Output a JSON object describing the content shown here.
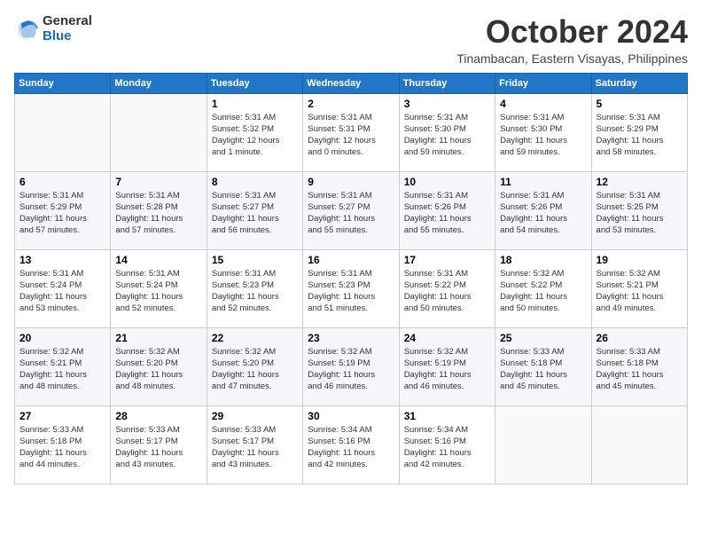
{
  "logo": {
    "general": "General",
    "blue": "Blue"
  },
  "title": "October 2024",
  "location": "Tinambacan, Eastern Visayas, Philippines",
  "days_of_week": [
    "Sunday",
    "Monday",
    "Tuesday",
    "Wednesday",
    "Thursday",
    "Friday",
    "Saturday"
  ],
  "weeks": [
    [
      {
        "day": "",
        "content": ""
      },
      {
        "day": "",
        "content": ""
      },
      {
        "day": "1",
        "content": "Sunrise: 5:31 AM\nSunset: 5:32 PM\nDaylight: 12 hours\nand 1 minute."
      },
      {
        "day": "2",
        "content": "Sunrise: 5:31 AM\nSunset: 5:31 PM\nDaylight: 12 hours\nand 0 minutes."
      },
      {
        "day": "3",
        "content": "Sunrise: 5:31 AM\nSunset: 5:30 PM\nDaylight: 11 hours\nand 59 minutes."
      },
      {
        "day": "4",
        "content": "Sunrise: 5:31 AM\nSunset: 5:30 PM\nDaylight: 11 hours\nand 59 minutes."
      },
      {
        "day": "5",
        "content": "Sunrise: 5:31 AM\nSunset: 5:29 PM\nDaylight: 11 hours\nand 58 minutes."
      }
    ],
    [
      {
        "day": "6",
        "content": "Sunrise: 5:31 AM\nSunset: 5:29 PM\nDaylight: 11 hours\nand 57 minutes."
      },
      {
        "day": "7",
        "content": "Sunrise: 5:31 AM\nSunset: 5:28 PM\nDaylight: 11 hours\nand 57 minutes."
      },
      {
        "day": "8",
        "content": "Sunrise: 5:31 AM\nSunset: 5:27 PM\nDaylight: 11 hours\nand 56 minutes."
      },
      {
        "day": "9",
        "content": "Sunrise: 5:31 AM\nSunset: 5:27 PM\nDaylight: 11 hours\nand 55 minutes."
      },
      {
        "day": "10",
        "content": "Sunrise: 5:31 AM\nSunset: 5:26 PM\nDaylight: 11 hours\nand 55 minutes."
      },
      {
        "day": "11",
        "content": "Sunrise: 5:31 AM\nSunset: 5:26 PM\nDaylight: 11 hours\nand 54 minutes."
      },
      {
        "day": "12",
        "content": "Sunrise: 5:31 AM\nSunset: 5:25 PM\nDaylight: 11 hours\nand 53 minutes."
      }
    ],
    [
      {
        "day": "13",
        "content": "Sunrise: 5:31 AM\nSunset: 5:24 PM\nDaylight: 11 hours\nand 53 minutes."
      },
      {
        "day": "14",
        "content": "Sunrise: 5:31 AM\nSunset: 5:24 PM\nDaylight: 11 hours\nand 52 minutes."
      },
      {
        "day": "15",
        "content": "Sunrise: 5:31 AM\nSunset: 5:23 PM\nDaylight: 11 hours\nand 52 minutes."
      },
      {
        "day": "16",
        "content": "Sunrise: 5:31 AM\nSunset: 5:23 PM\nDaylight: 11 hours\nand 51 minutes."
      },
      {
        "day": "17",
        "content": "Sunrise: 5:31 AM\nSunset: 5:22 PM\nDaylight: 11 hours\nand 50 minutes."
      },
      {
        "day": "18",
        "content": "Sunrise: 5:32 AM\nSunset: 5:22 PM\nDaylight: 11 hours\nand 50 minutes."
      },
      {
        "day": "19",
        "content": "Sunrise: 5:32 AM\nSunset: 5:21 PM\nDaylight: 11 hours\nand 49 minutes."
      }
    ],
    [
      {
        "day": "20",
        "content": "Sunrise: 5:32 AM\nSunset: 5:21 PM\nDaylight: 11 hours\nand 48 minutes."
      },
      {
        "day": "21",
        "content": "Sunrise: 5:32 AM\nSunset: 5:20 PM\nDaylight: 11 hours\nand 48 minutes."
      },
      {
        "day": "22",
        "content": "Sunrise: 5:32 AM\nSunset: 5:20 PM\nDaylight: 11 hours\nand 47 minutes."
      },
      {
        "day": "23",
        "content": "Sunrise: 5:32 AM\nSunset: 5:19 PM\nDaylight: 11 hours\nand 46 minutes."
      },
      {
        "day": "24",
        "content": "Sunrise: 5:32 AM\nSunset: 5:19 PM\nDaylight: 11 hours\nand 46 minutes."
      },
      {
        "day": "25",
        "content": "Sunrise: 5:33 AM\nSunset: 5:18 PM\nDaylight: 11 hours\nand 45 minutes."
      },
      {
        "day": "26",
        "content": "Sunrise: 5:33 AM\nSunset: 5:18 PM\nDaylight: 11 hours\nand 45 minutes."
      }
    ],
    [
      {
        "day": "27",
        "content": "Sunrise: 5:33 AM\nSunset: 5:18 PM\nDaylight: 11 hours\nand 44 minutes."
      },
      {
        "day": "28",
        "content": "Sunrise: 5:33 AM\nSunset: 5:17 PM\nDaylight: 11 hours\nand 43 minutes."
      },
      {
        "day": "29",
        "content": "Sunrise: 5:33 AM\nSunset: 5:17 PM\nDaylight: 11 hours\nand 43 minutes."
      },
      {
        "day": "30",
        "content": "Sunrise: 5:34 AM\nSunset: 5:16 PM\nDaylight: 11 hours\nand 42 minutes."
      },
      {
        "day": "31",
        "content": "Sunrise: 5:34 AM\nSunset: 5:16 PM\nDaylight: 11 hours\nand 42 minutes."
      },
      {
        "day": "",
        "content": ""
      },
      {
        "day": "",
        "content": ""
      }
    ]
  ]
}
